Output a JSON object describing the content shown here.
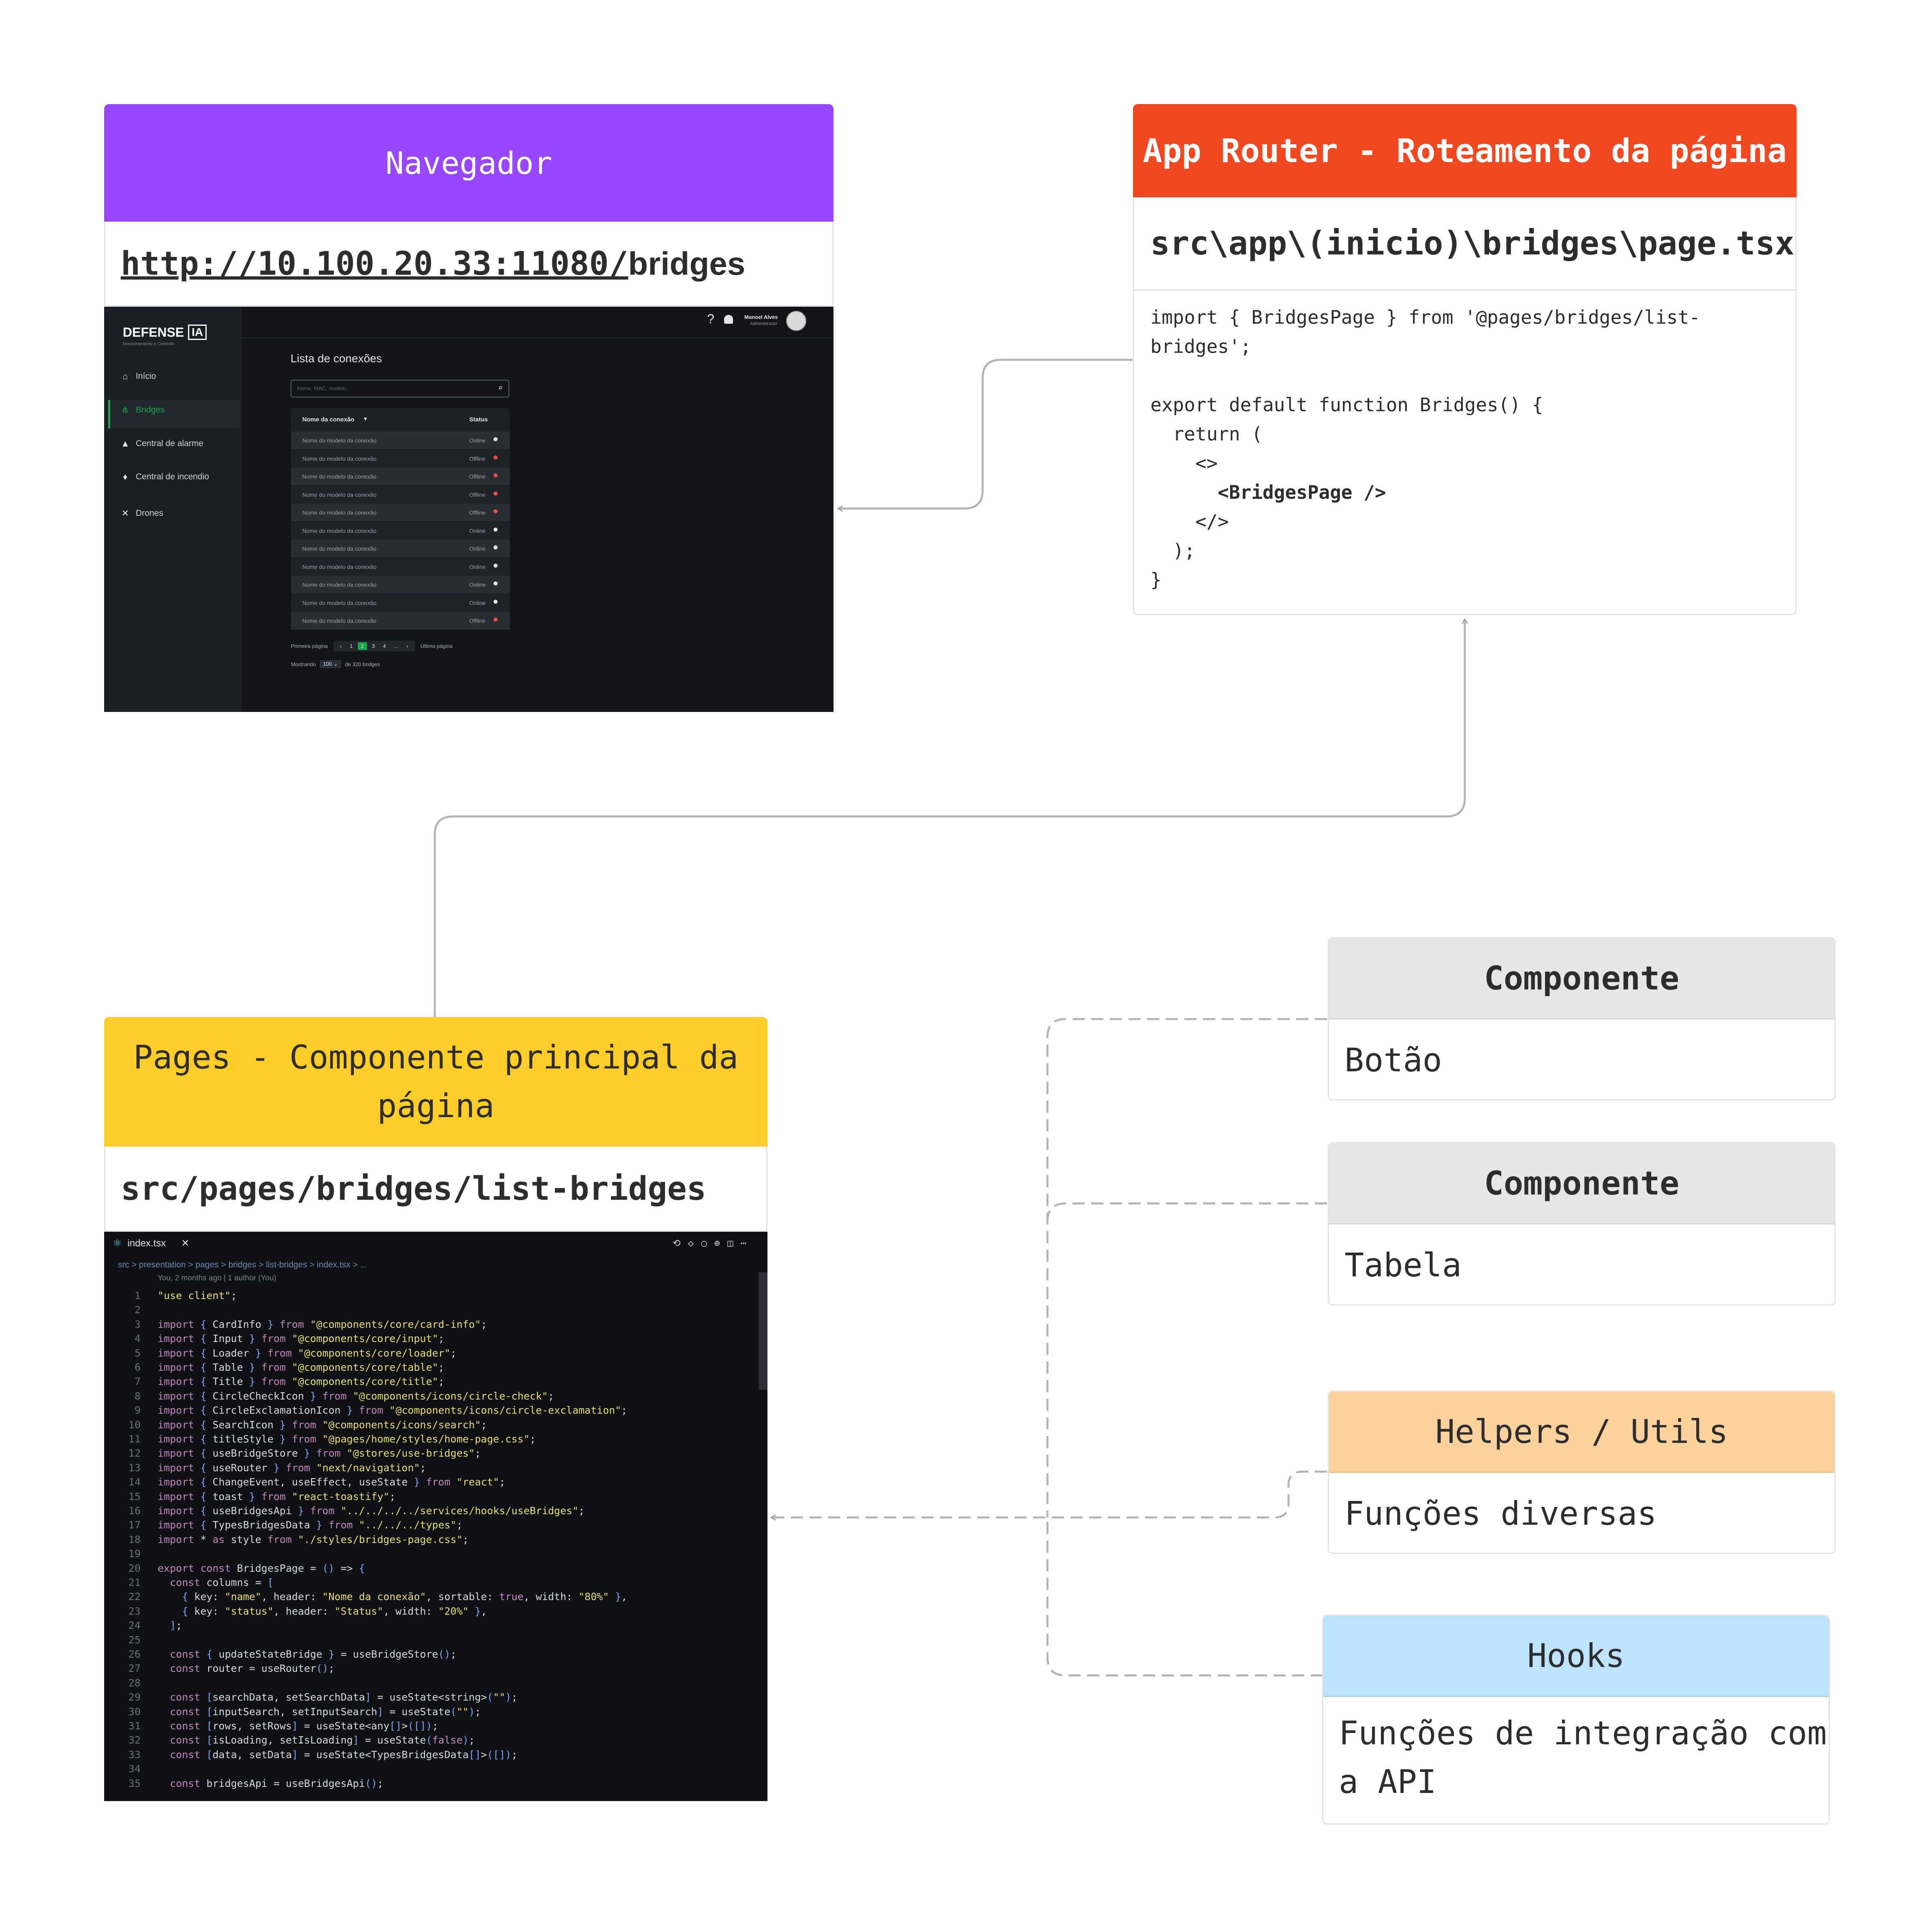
{
  "browser": {
    "title": "Navegador",
    "url_prefix": "http://10.100.20.33:11080/",
    "url_suffix": "bridges",
    "app": {
      "brand": "DEFENSE",
      "brand_badge": "IA",
      "brand_sub": "Monitoramento e Controle",
      "user_name": "Manoel Alves",
      "user_role": "Administrador",
      "help_icon": "?",
      "sidebar": [
        {
          "label": "Início",
          "icon": "home-icon",
          "glyph": "⌂"
        },
        {
          "label": "Bridges",
          "icon": "bridges-icon",
          "glyph": "⋔"
        },
        {
          "label": "Central de alarme",
          "icon": "bell-icon",
          "glyph": "🔔"
        },
        {
          "label": "Central de incendio",
          "icon": "flame-icon",
          "glyph": "♨"
        },
        {
          "label": "Drones",
          "icon": "drone-icon",
          "glyph": "✕"
        }
      ],
      "page_heading": "Lista de conexões",
      "search_placeholder": "Nome, MAC, modelo..",
      "col_name": "Nome da conexão",
      "col_status": "Status",
      "rows": [
        {
          "name": "Nome do modelo da conexão",
          "status": "Online"
        },
        {
          "name": "Nome do modelo da conexão",
          "status": "Offline"
        },
        {
          "name": "Nome do modelo da conexão",
          "status": "Offline"
        },
        {
          "name": "Nome do modelo da conexão",
          "status": "Offline"
        },
        {
          "name": "Nome do modelo da conexão",
          "status": "Offline"
        },
        {
          "name": "Nome do modelo da conexão",
          "status": "Online"
        },
        {
          "name": "Nome do modelo da conexão",
          "status": "Online"
        },
        {
          "name": "Nome do modelo da conexão",
          "status": "Online"
        },
        {
          "name": "Nome do modelo da conexão",
          "status": "Online"
        },
        {
          "name": "Nome do modelo da conexão",
          "status": "Online"
        },
        {
          "name": "Nome do modelo da conexão",
          "status": "Offline"
        }
      ],
      "pager_first": "Primeira página",
      "pager_last": "Última página",
      "pages": [
        "‹",
        "1",
        "2",
        "3",
        "4",
        "...",
        "›"
      ],
      "showing": "Mostrando",
      "page_size": "100",
      "total": "de 320 bridges"
    }
  },
  "router": {
    "title": "App Router - Roteamento da página",
    "path": "src\\app\\(inicio)\\bridges\\page.tsx",
    "code": [
      "import { BridgesPage } from '@pages/bridges/list-",
      "bridges';",
      "",
      "export default function Bridges() {",
      "  return (",
      "    <>",
      "      <BridgesPage />",
      "    </>",
      "  );",
      "}"
    ]
  },
  "pages": {
    "title_line1": "Pages - Componente principal da",
    "title_line2": "página",
    "path": "src/pages/bridges/list-bridges",
    "editor": {
      "tab": "index.tsx",
      "breadcrumb": "src > presentation > pages > bridges > list-bridges > index.tsx > ...",
      "blame": "You, 2 months ago | 1 author (You)",
      "lines": [
        {
          "n": "1",
          "t": "\"use client\";"
        },
        {
          "n": "2",
          "t": ""
        },
        {
          "n": "3",
          "t": "import { CardInfo } from \"@components/core/card-info\";"
        },
        {
          "n": "4",
          "t": "import { Input } from \"@components/core/input\";"
        },
        {
          "n": "5",
          "t": "import { Loader } from \"@components/core/loader\";"
        },
        {
          "n": "6",
          "t": "import { Table } from \"@components/core/table\";"
        },
        {
          "n": "7",
          "t": "import { Title } from \"@components/core/title\";"
        },
        {
          "n": "8",
          "t": "import { CircleCheckIcon } from \"@components/icons/circle-check\";"
        },
        {
          "n": "9",
          "t": "import { CircleExclamationIcon } from \"@components/icons/circle-exclamation\";"
        },
        {
          "n": "10",
          "t": "import { SearchIcon } from \"@components/icons/search\";"
        },
        {
          "n": "11",
          "t": "import { titleStyle } from \"@pages/home/styles/home-page.css\";"
        },
        {
          "n": "12",
          "t": "import { useBridgeStore } from \"@stores/use-bridges\";"
        },
        {
          "n": "13",
          "t": "import { useRouter } from \"next/navigation\";"
        },
        {
          "n": "14",
          "t": "import { ChangeEvent, useEffect, useState } from \"react\";"
        },
        {
          "n": "15",
          "t": "import { toast } from \"react-toastify\";"
        },
        {
          "n": "16",
          "t": "import { useBridgesApi } from \"../../../../services/hooks/useBridges\";"
        },
        {
          "n": "17",
          "t": "import { TypesBridgesData } from \"../../../types\";"
        },
        {
          "n": "18",
          "t": "import * as style from \"./styles/bridges-page.css\";"
        },
        {
          "n": "19",
          "t": ""
        },
        {
          "n": "20",
          "t": "export const BridgesPage = () => {"
        },
        {
          "n": "21",
          "t": "  const columns = ["
        },
        {
          "n": "22",
          "t": "    { key: \"name\", header: \"Nome da conexão\", sortable: true, width: \"80%\" },"
        },
        {
          "n": "23",
          "t": "    { key: \"status\", header: \"Status\", width: \"20%\" },"
        },
        {
          "n": "24",
          "t": "  ];"
        },
        {
          "n": "25",
          "t": ""
        },
        {
          "n": "26",
          "t": "  const { updateStateBridge } = useBridgeStore();"
        },
        {
          "n": "27",
          "t": "  const router = useRouter();"
        },
        {
          "n": "28",
          "t": ""
        },
        {
          "n": "29",
          "t": "  const [searchData, setSearchData] = useState<string>(\"\");"
        },
        {
          "n": "30",
          "t": "  const [inputSearch, setInputSearch] = useState(\"\");"
        },
        {
          "n": "31",
          "t": "  const [rows, setRows] = useState<any[]>([]);"
        },
        {
          "n": "32",
          "t": "  const [isLoading, setIsLoading] = useState(false);"
        },
        {
          "n": "33",
          "t": "  const [data, setData] = useState<TypesBridgesData[]>([]);"
        },
        {
          "n": "34",
          "t": ""
        },
        {
          "n": "35",
          "t": "  const bridgesApi = useBridgesApi();"
        }
      ]
    }
  },
  "components": [
    {
      "title": "Componente",
      "body": "Botão"
    },
    {
      "title": "Componente",
      "body": "Tabela"
    }
  ],
  "helpers": {
    "title": "Helpers / Utils",
    "body": "Funções diversas"
  },
  "hooks": {
    "title": "Hooks",
    "body_line1": "Funções de integração com",
    "body_line2": "a API"
  },
  "colors": {
    "browser_header": "#9747ff",
    "router_header": "#f24822",
    "pages_header": "#ffcd29",
    "component_header": "#e6e6e6",
    "helpers_header": "#fcd19c",
    "hooks_header": "#bde3ff",
    "connector": "#b3b3b3"
  }
}
